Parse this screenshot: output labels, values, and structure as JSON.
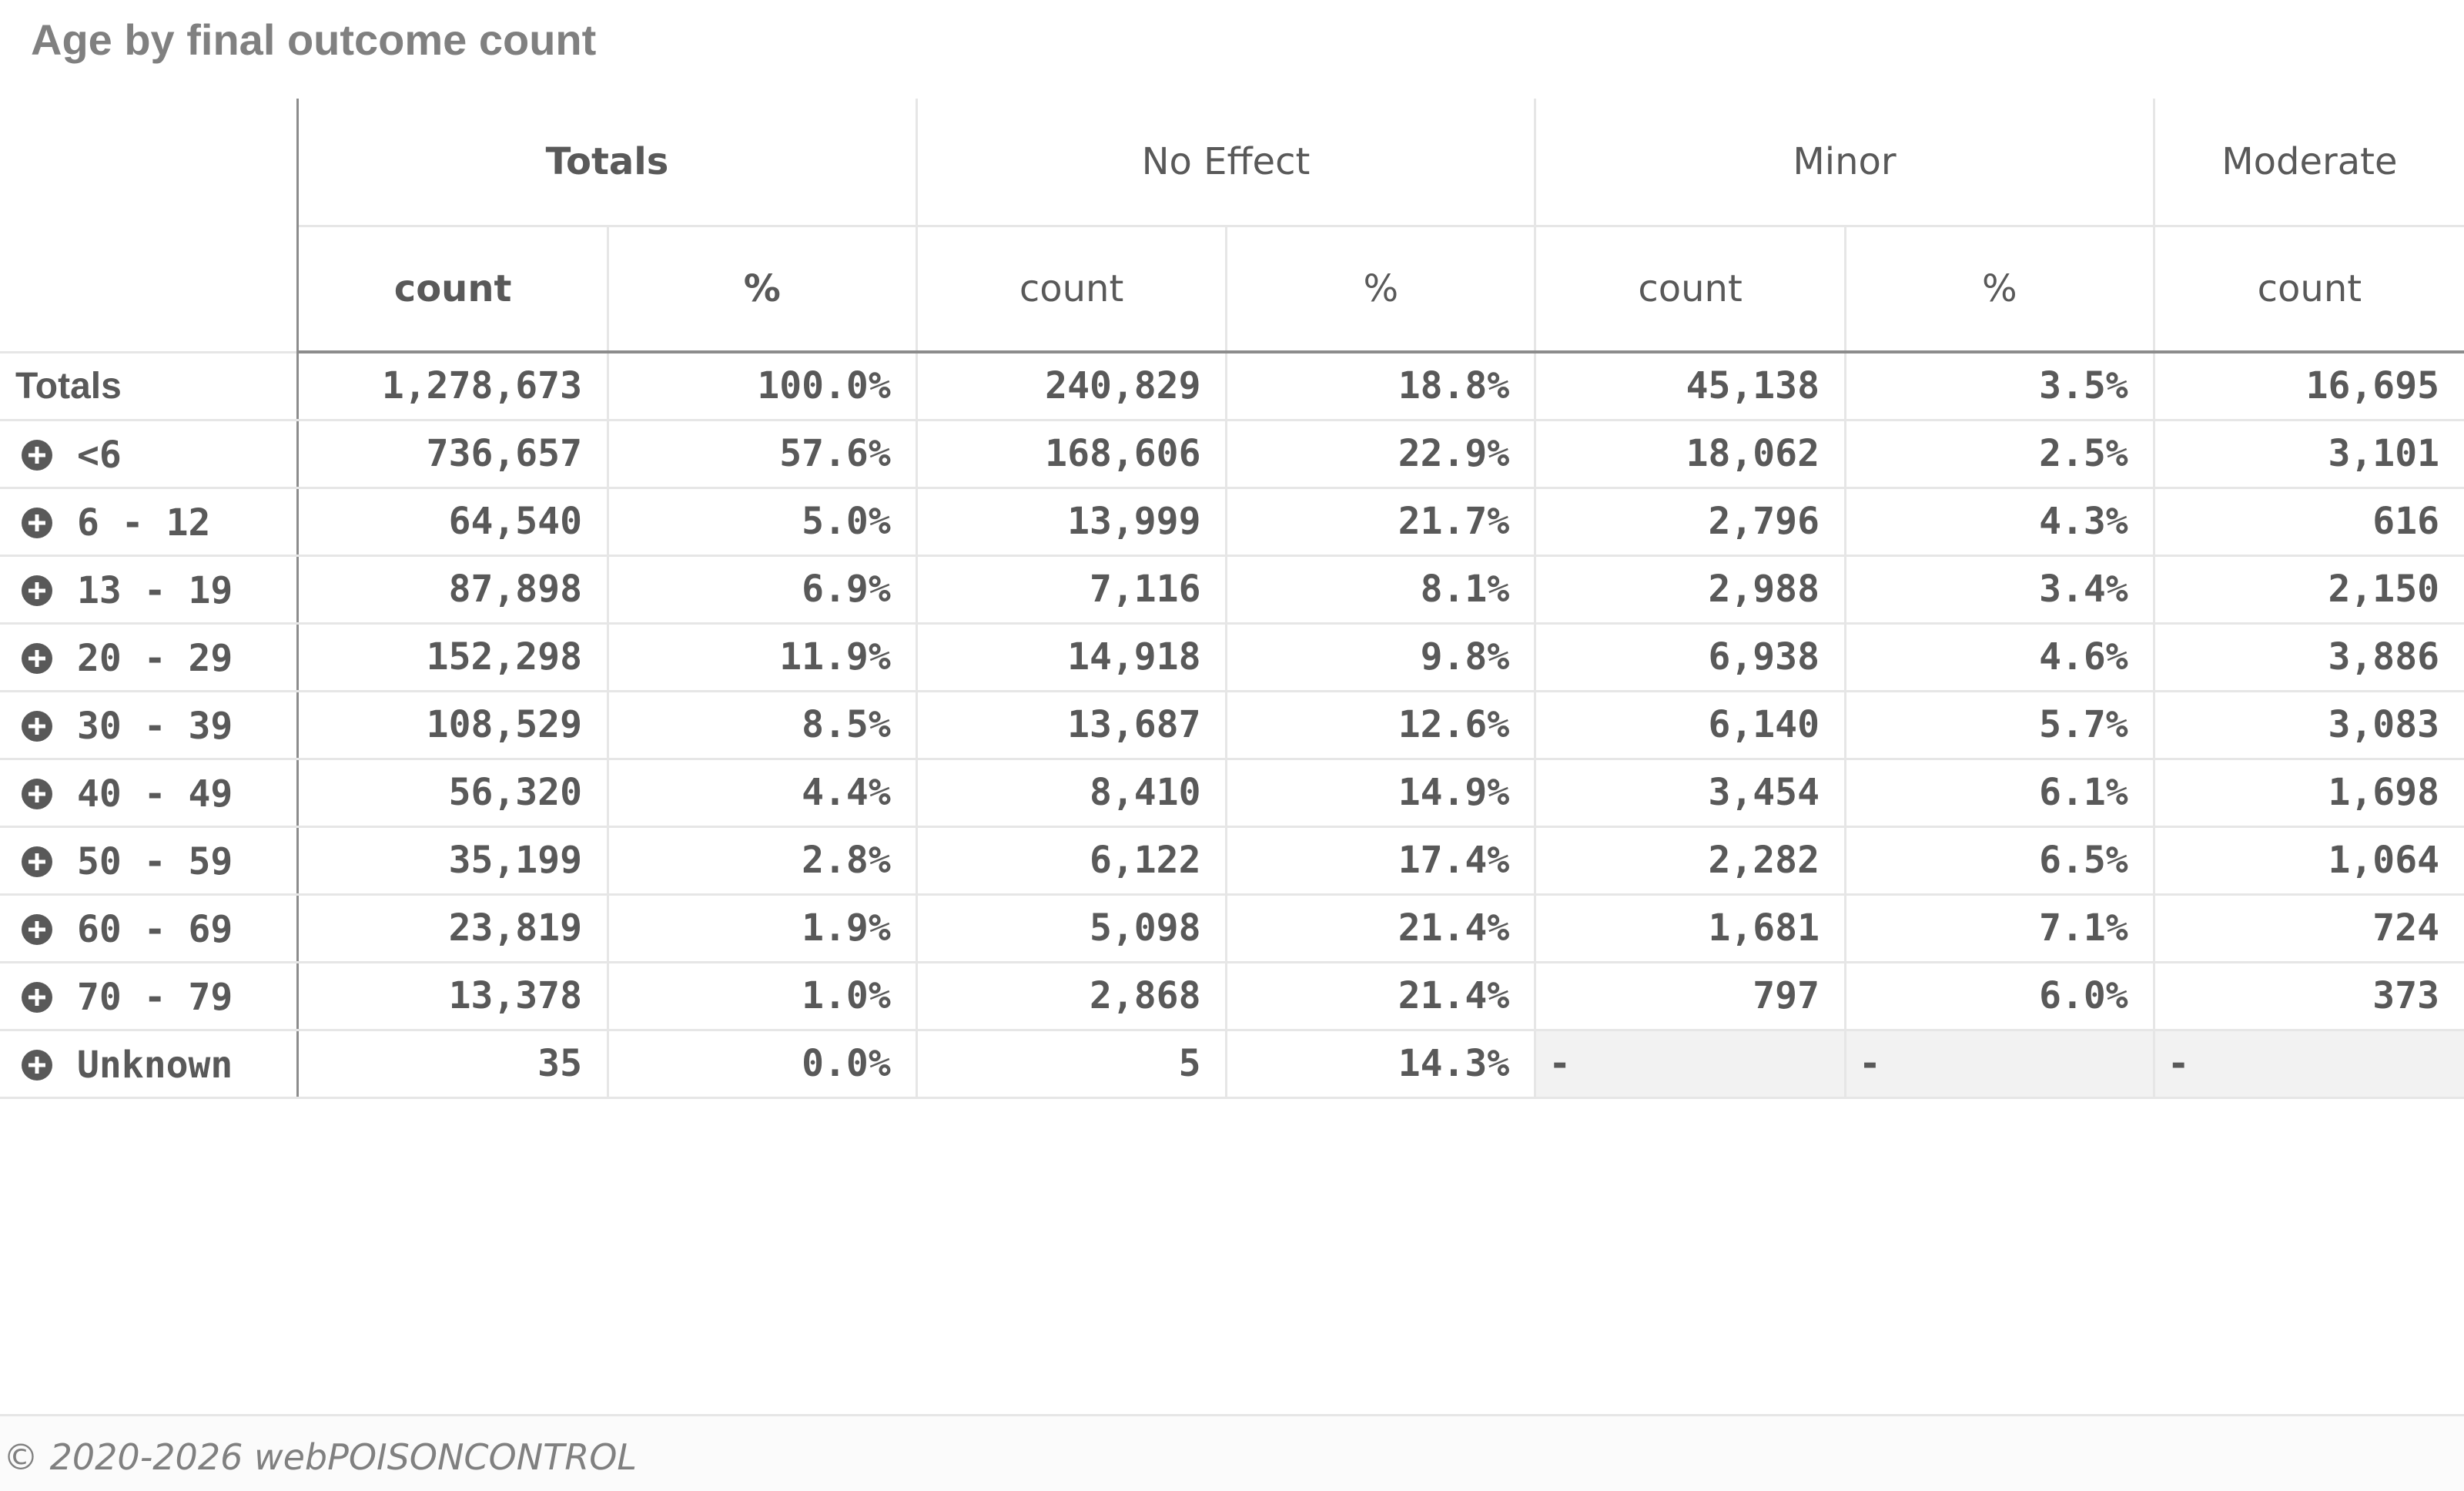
{
  "title": "Age by final outcome count",
  "header": {
    "groups": [
      "Totals",
      "No Effect",
      "Minor",
      "Moderate"
    ],
    "measures": [
      "count",
      "%",
      "count",
      "%",
      "count",
      "%",
      "count"
    ]
  },
  "rows": [
    {
      "label": "Totals",
      "values": [
        "1,278,673",
        "100.0%",
        "240,829",
        "18.8%",
        "45,138",
        "3.5%",
        "16,695"
      ]
    },
    {
      "label": "<6",
      "values": [
        "736,657",
        "57.6%",
        "168,606",
        "22.9%",
        "18,062",
        "2.5%",
        "3,101"
      ]
    },
    {
      "label": "6 - 12",
      "values": [
        "64,540",
        "5.0%",
        "13,999",
        "21.7%",
        "2,796",
        "4.3%",
        "616"
      ]
    },
    {
      "label": "13 - 19",
      "values": [
        "87,898",
        "6.9%",
        "7,116",
        "8.1%",
        "2,988",
        "3.4%",
        "2,150"
      ]
    },
    {
      "label": "20 - 29",
      "values": [
        "152,298",
        "11.9%",
        "14,918",
        "9.8%",
        "6,938",
        "4.6%",
        "3,886"
      ]
    },
    {
      "label": "30 - 39",
      "values": [
        "108,529",
        "8.5%",
        "13,687",
        "12.6%",
        "6,140",
        "5.7%",
        "3,083"
      ]
    },
    {
      "label": "40 - 49",
      "values": [
        "56,320",
        "4.4%",
        "8,410",
        "14.9%",
        "3,454",
        "6.1%",
        "1,698"
      ]
    },
    {
      "label": "50 - 59",
      "values": [
        "35,199",
        "2.8%",
        "6,122",
        "17.4%",
        "2,282",
        "6.5%",
        "1,064"
      ]
    },
    {
      "label": "60 - 69",
      "values": [
        "23,819",
        "1.9%",
        "5,098",
        "21.4%",
        "1,681",
        "7.1%",
        "724"
      ]
    },
    {
      "label": "70 - 79",
      "values": [
        "13,378",
        "1.0%",
        "2,868",
        "21.4%",
        "797",
        "6.0%",
        "373"
      ]
    },
    {
      "label": "Unknown",
      "values": [
        "35",
        "0.0%",
        "5",
        "14.3%",
        "-",
        "-",
        "-"
      ]
    }
  ],
  "icons": {
    "expand": "plus-circle-icon"
  },
  "footer": {
    "text": "© 2020-2026 webPOISONCONTROL"
  }
}
